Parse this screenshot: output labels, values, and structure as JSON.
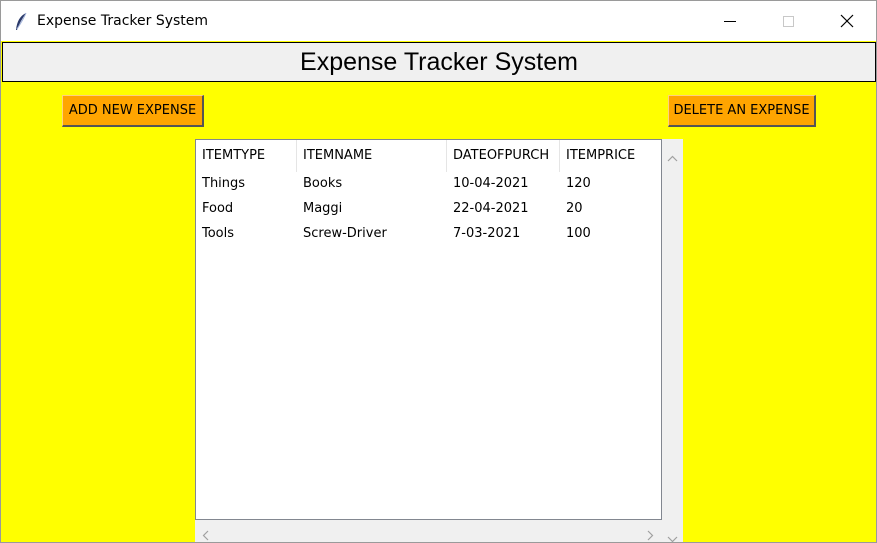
{
  "window": {
    "title": "Expense Tracker System",
    "icon": "feather-icon"
  },
  "header": {
    "title": "Expense Tracker System"
  },
  "buttons": {
    "add_label": "ADD NEW EXPENSE",
    "delete_label": "DELETE AN EXPENSE"
  },
  "table": {
    "columns": [
      "ITEMTYPE",
      "ITEMNAME",
      "DATEOFPURCH",
      "ITEMPRICE"
    ],
    "rows": [
      [
        "Things",
        "Books",
        "10-04-2021",
        "120"
      ],
      [
        "Food",
        "Maggi",
        "22-04-2021",
        "20"
      ],
      [
        "Tools",
        "Screw-Driver",
        "7-03-2021",
        "100"
      ]
    ]
  },
  "colors": {
    "background": "#ffff00",
    "button": "#ffa500",
    "header_bar": "#f0f0f0"
  }
}
